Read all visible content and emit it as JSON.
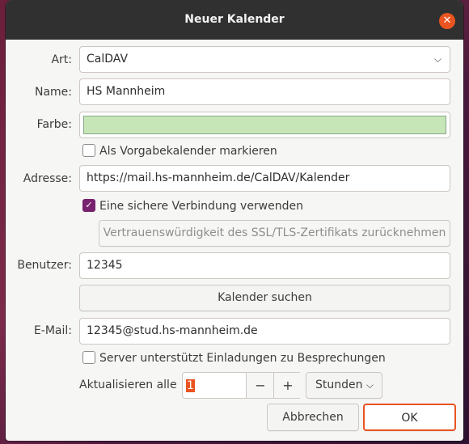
{
  "window": {
    "title": "Neuer Kalender",
    "close_glyph": "✕"
  },
  "form": {
    "art": {
      "label": "Art:",
      "value": "CalDAV",
      "chevron": "⌵"
    },
    "name": {
      "label": "Name:",
      "value": "HS Mannheim"
    },
    "farbe": {
      "label": "Farbe:",
      "color": "#c6e6b8"
    },
    "default_calendar": {
      "label": "Als Vorgabekalender markieren",
      "checked": false
    },
    "adresse": {
      "label": "Adresse:",
      "value": "https://mail.hs-mannheim.de/CalDAV/Kalender"
    },
    "secure_connection": {
      "label": "Eine sichere Verbindung verwenden",
      "checked": true,
      "check_glyph": "✓"
    },
    "revoke_ssl_button": "Vertrauenswürdigkeit des SSL/TLS-Zertifikats zurücknehmen",
    "benutzer": {
      "label": "Benutzer:",
      "value": "12345"
    },
    "find_calendar_button": "Kalender suchen",
    "email": {
      "label": "E-Mail:",
      "value": "12345@stud.hs-mannheim.de"
    },
    "invitations": {
      "label": "Server unterstützt Einladungen zu Besprechungen",
      "checked": false
    },
    "refresh": {
      "label": "Aktualisieren alle",
      "value": "1",
      "minus": "−",
      "plus": "+",
      "unit": "Stunden",
      "unit_chevron": "⌵"
    }
  },
  "buttons": {
    "cancel": "Abbrechen",
    "ok": "OK"
  },
  "colors": {
    "titlebar": "#303030",
    "close": "#e95420",
    "accent_check": "#77216f",
    "ok_border": "#e95420"
  }
}
